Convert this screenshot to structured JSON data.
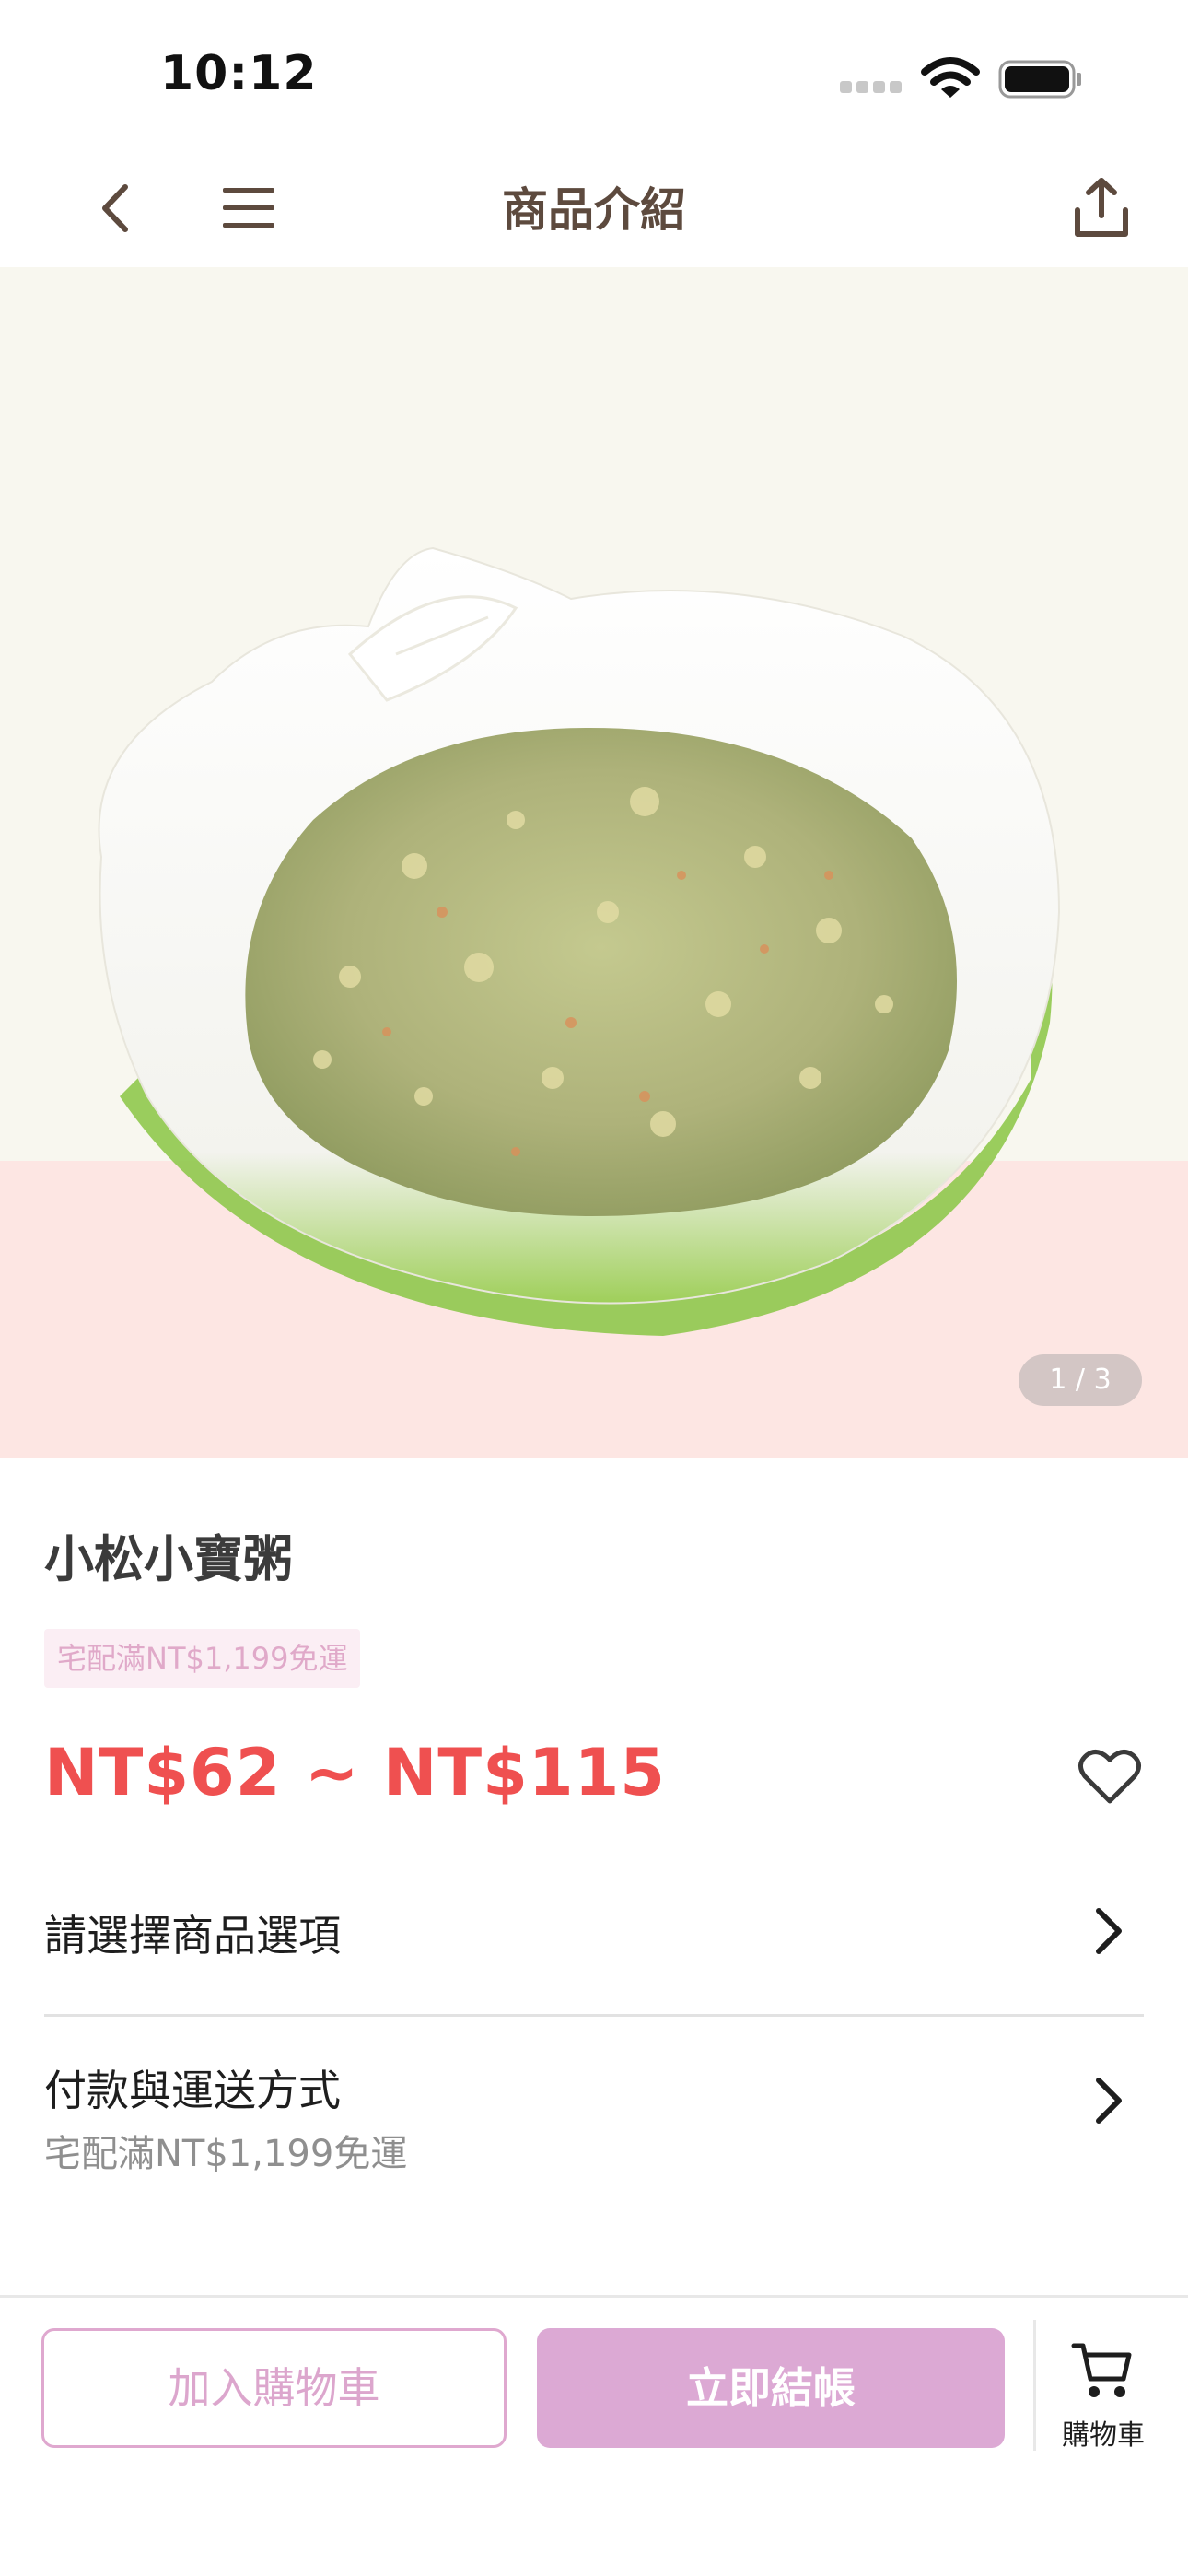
{
  "status_bar": {
    "time": "10:12"
  },
  "nav": {
    "title": "商品介紹",
    "icons": [
      "chevron-left-icon",
      "hamburger-menu-icon",
      "share-icon"
    ]
  },
  "hero": {
    "counter": "1 / 3",
    "image": "porridge-bowl-photo",
    "colors": {
      "top_background": "#f8f7ef",
      "bottom_background": "#fde6e3"
    }
  },
  "product": {
    "name": "小松小寶粥",
    "shipping_badge": "宅配滿NT$1,199免運",
    "price": "NT$62 ~ NT$115",
    "price_color": "#ef5050"
  },
  "rows": {
    "options": {
      "label": "請選擇商品選項"
    },
    "payment": {
      "label": "付款與運送方式",
      "sub": "宅配滿NT$1,199免運"
    }
  },
  "bottom_bar": {
    "add_to_cart": "加入購物車",
    "checkout": "立即結帳",
    "cart_label": "購物車",
    "accent_color": "#dca9d4"
  }
}
